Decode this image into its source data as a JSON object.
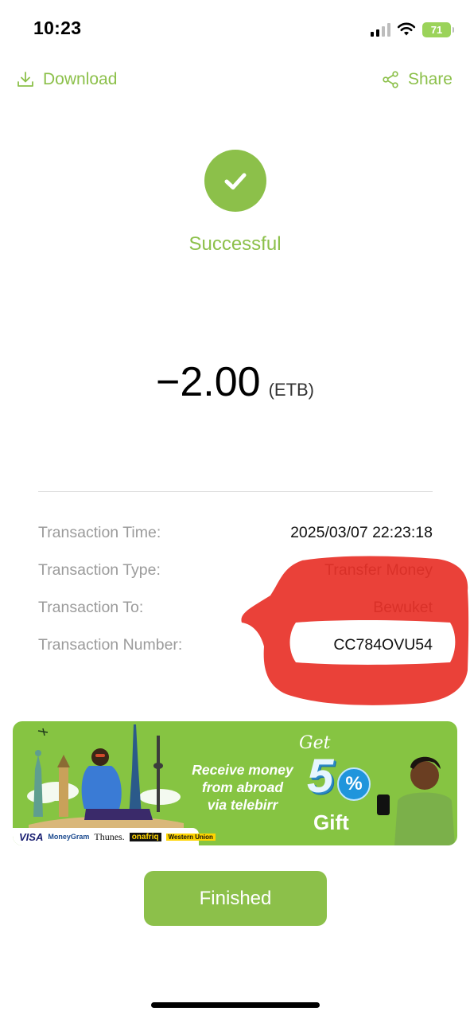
{
  "status_bar": {
    "time": "10:23",
    "battery": "71"
  },
  "actions": {
    "download_label": "Download",
    "share_label": "Share"
  },
  "status": {
    "label": "Successful"
  },
  "amount": {
    "value": "−2.00",
    "currency": "(ETB)"
  },
  "details": [
    {
      "label": "Transaction Time:",
      "value": "2025/03/07 22:23:18"
    },
    {
      "label": "Transaction Type:",
      "value": "Transfer Money"
    },
    {
      "label": "Transaction To:",
      "value": "Bewuket"
    },
    {
      "label": "Transaction Number:",
      "value": "CC784OVU54"
    }
  ],
  "banner": {
    "line1": "Receive money",
    "line2": "from abroad",
    "line3": "via telebirr",
    "get": "Get",
    "percent_number": "5",
    "percent_sign": "%",
    "gift": "Gift",
    "partners": [
      "VISA",
      "MoneyGram",
      "Thunes.",
      "onafriq",
      "Western Union"
    ]
  },
  "finish_label": "Finished",
  "colors": {
    "accent": "#8cc04a",
    "redaction": "#e8332a"
  }
}
